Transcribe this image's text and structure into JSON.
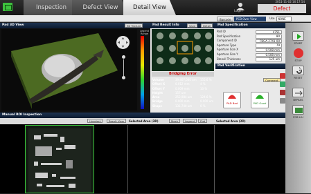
{
  "header": {
    "tabs": [
      "Inspection",
      "Defect View",
      "Detail View"
    ],
    "login": "Login",
    "clock": "2011-11-02 16:17:54",
    "status": "Defect"
  },
  "toolbar": {
    "barcode": "Barcode",
    "selected": "PCB Over View",
    "use": "Use",
    "use_value": "NONE"
  },
  "pad3d": {
    "title": "Pad 3D View",
    "btn": "3D Texture",
    "legend": "Legend Range"
  },
  "result": {
    "title": "Pad Result Info",
    "save": "Save",
    "detail": "Detail",
    "error": "Bridging Error",
    "rows": [
      [
        "Volume",
        "39,407,040 um",
        "155.6 %"
      ],
      [
        "Offset X",
        "0.012 mm",
        "4 %"
      ],
      [
        "Offset Y",
        "0.009 mm",
        "10 %"
      ],
      [
        "Height",
        "157 um",
        ""
      ],
      [
        "Area",
        "252,984 um",
        "124.6 %"
      ],
      [
        "Bridge",
        "0.000 mm",
        "0.000 um"
      ],
      [
        "Shape",
        "131,740 um",
        "0 %"
      ]
    ]
  },
  "spec": {
    "title": "Pad Specification",
    "rows": [
      [
        "Pad ID",
        "4751"
      ],
      [
        "Pad Specification",
        "80"
      ],
      [
        "Component ID",
        "FBGA-2741-00"
      ],
      [
        "Aperture Type",
        "79"
      ],
      [
        "Aperture Size X",
        "0.508 mm"
      ],
      [
        "Aperture Size Y",
        "0.508 mm"
      ],
      [
        "Stencil Thickness",
        "125 um"
      ]
    ],
    "verify": "Pad Verification",
    "comment": "Comment",
    "bad": "PAD Bad",
    "good": "PAD Good"
  },
  "sidebar": {
    "labels": [
      "START",
      "STOP",
      "RESET",
      "BYPASS",
      "PCB LIU"
    ]
  },
  "roi": {
    "title": "Manual ROI Inspection",
    "unselect": "Unselect",
    "result_view": "Result View",
    "area1": "Selected Area (3D)",
    "mesh": "Mesh",
    "legend": "Legend",
    "flat": "Flat",
    "area2": "Selected Area (2D)"
  }
}
